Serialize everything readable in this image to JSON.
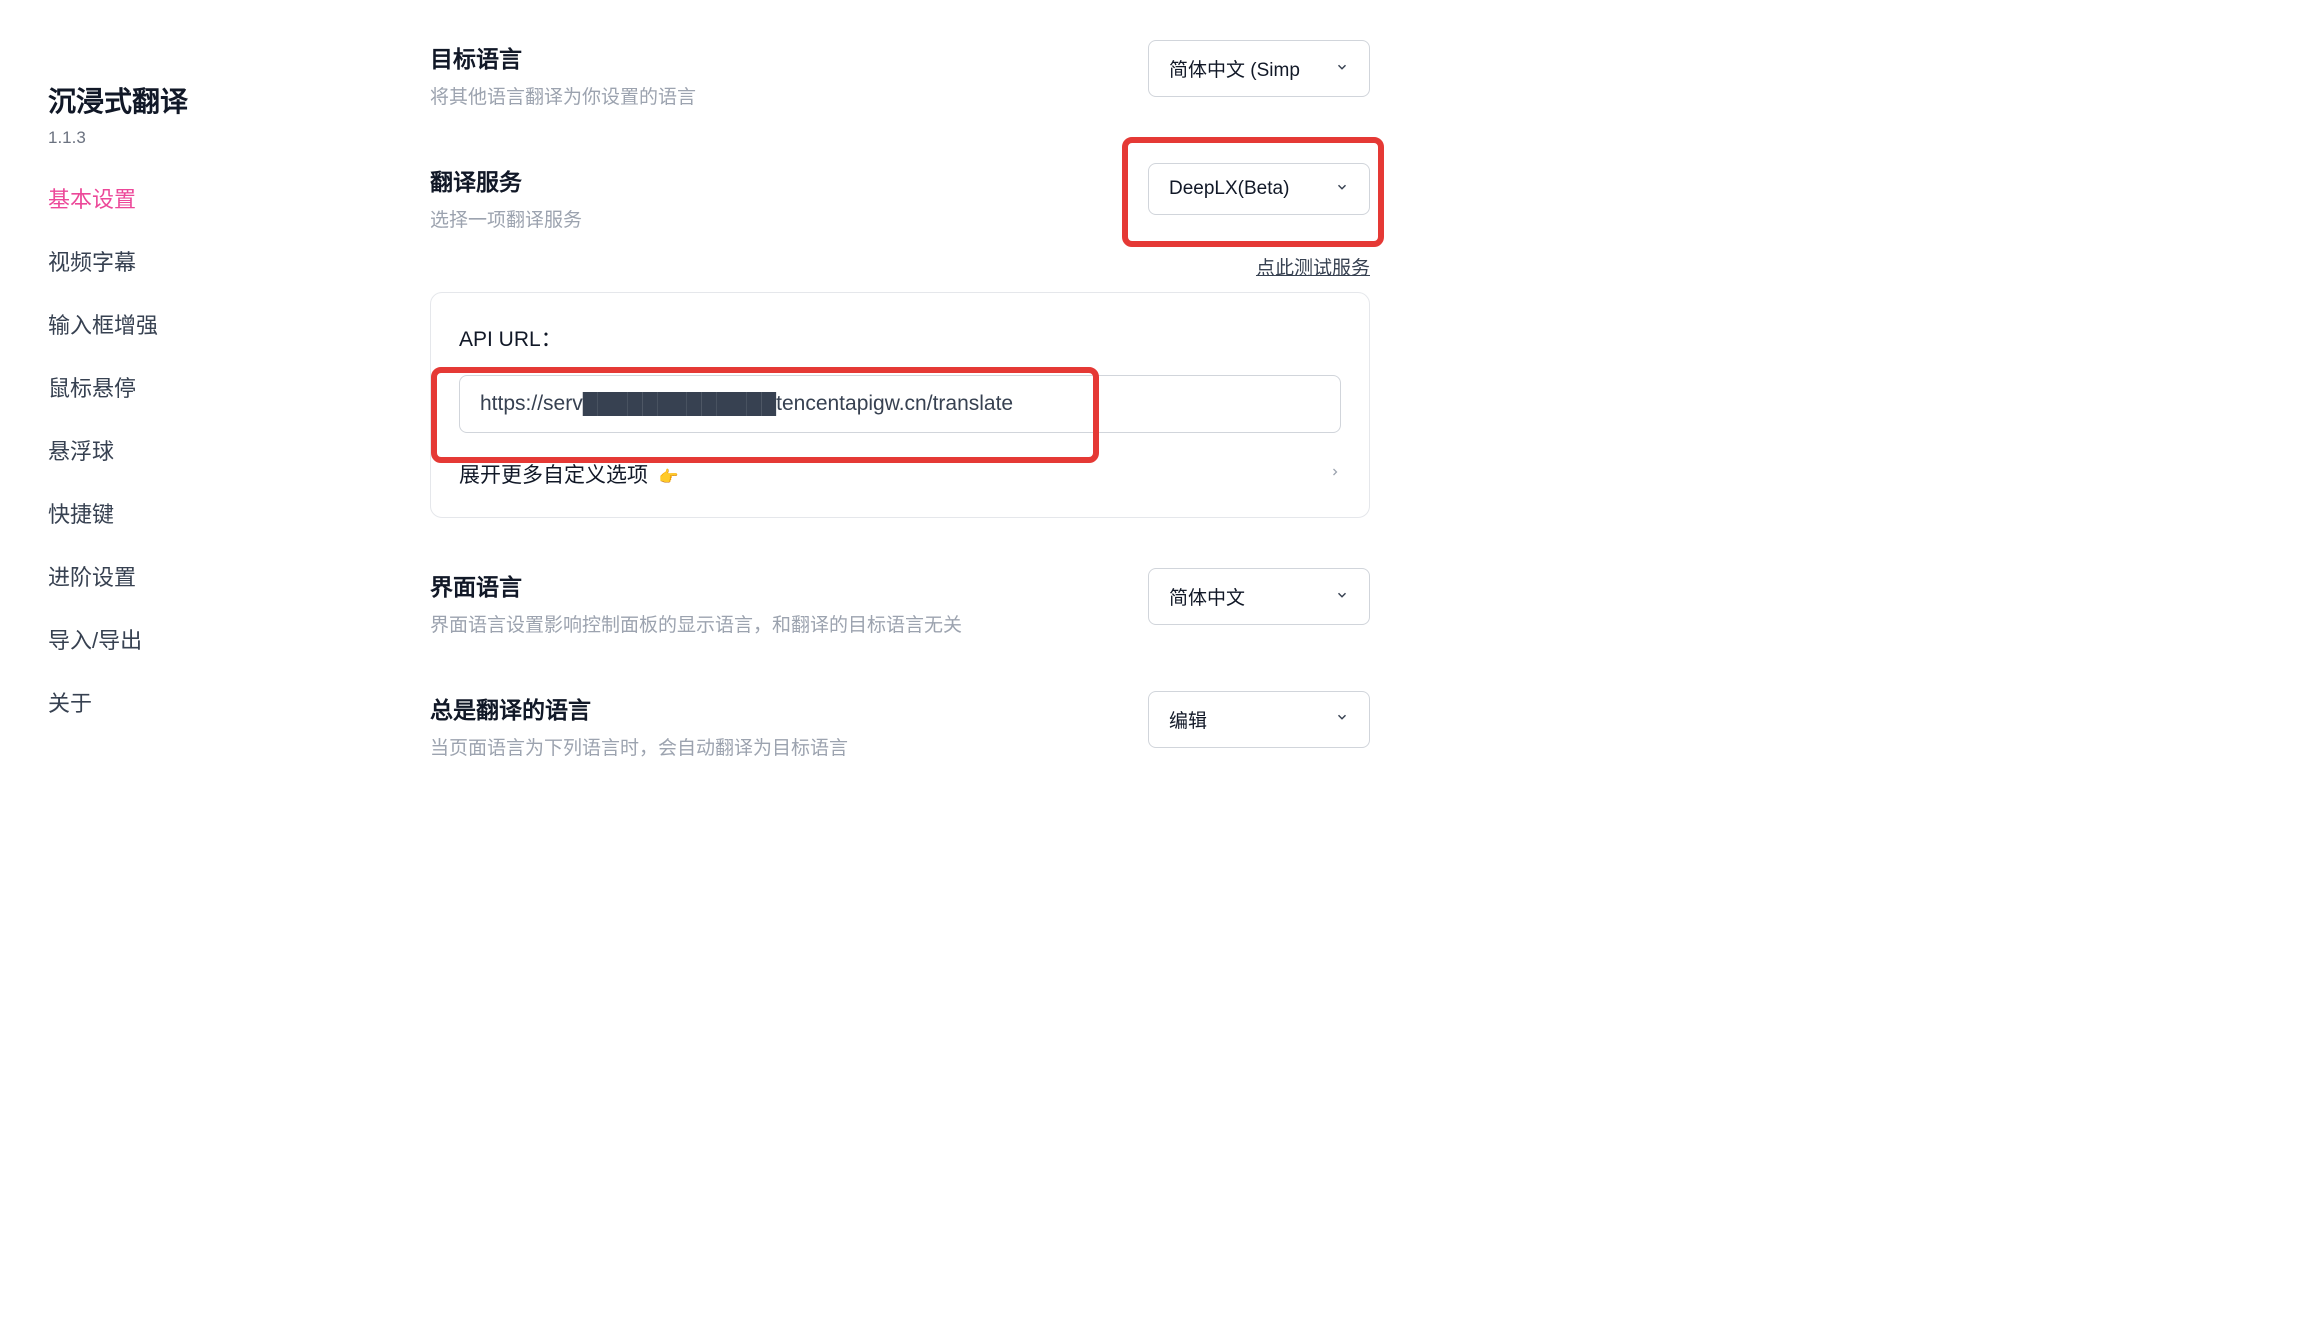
{
  "app": {
    "title": "沉浸式翻译",
    "version": "1.1.3"
  },
  "nav": {
    "items": [
      "基本设置",
      "视频字幕",
      "输入框增强",
      "鼠标悬停",
      "悬浮球",
      "快捷键",
      "进阶设置",
      "导入/导出",
      "关于"
    ],
    "activeIndex": 0
  },
  "sections": {
    "targetLang": {
      "title": "目标语言",
      "desc": "将其他语言翻译为你设置的语言",
      "selected": "简体中文 (Simp"
    },
    "service": {
      "title": "翻译服务",
      "desc": "选择一项翻译服务",
      "selected": "DeepLX(Beta)",
      "testLink": "点此测试服务"
    },
    "apiCard": {
      "label": "API URL：",
      "value": "https://serv█████████████tencentapigw.cn/translate",
      "expand": "展开更多自定义选项",
      "emoji": "👉"
    },
    "uiLang": {
      "title": "界面语言",
      "desc": "界面语言设置影响控制面板的显示语言，和翻译的目标语言无关",
      "selected": "简体中文"
    },
    "alwaysTranslate": {
      "title": "总是翻译的语言",
      "desc": "当页面语言为下列语言时，会自动翻译为目标语言",
      "selected": "编辑"
    }
  }
}
